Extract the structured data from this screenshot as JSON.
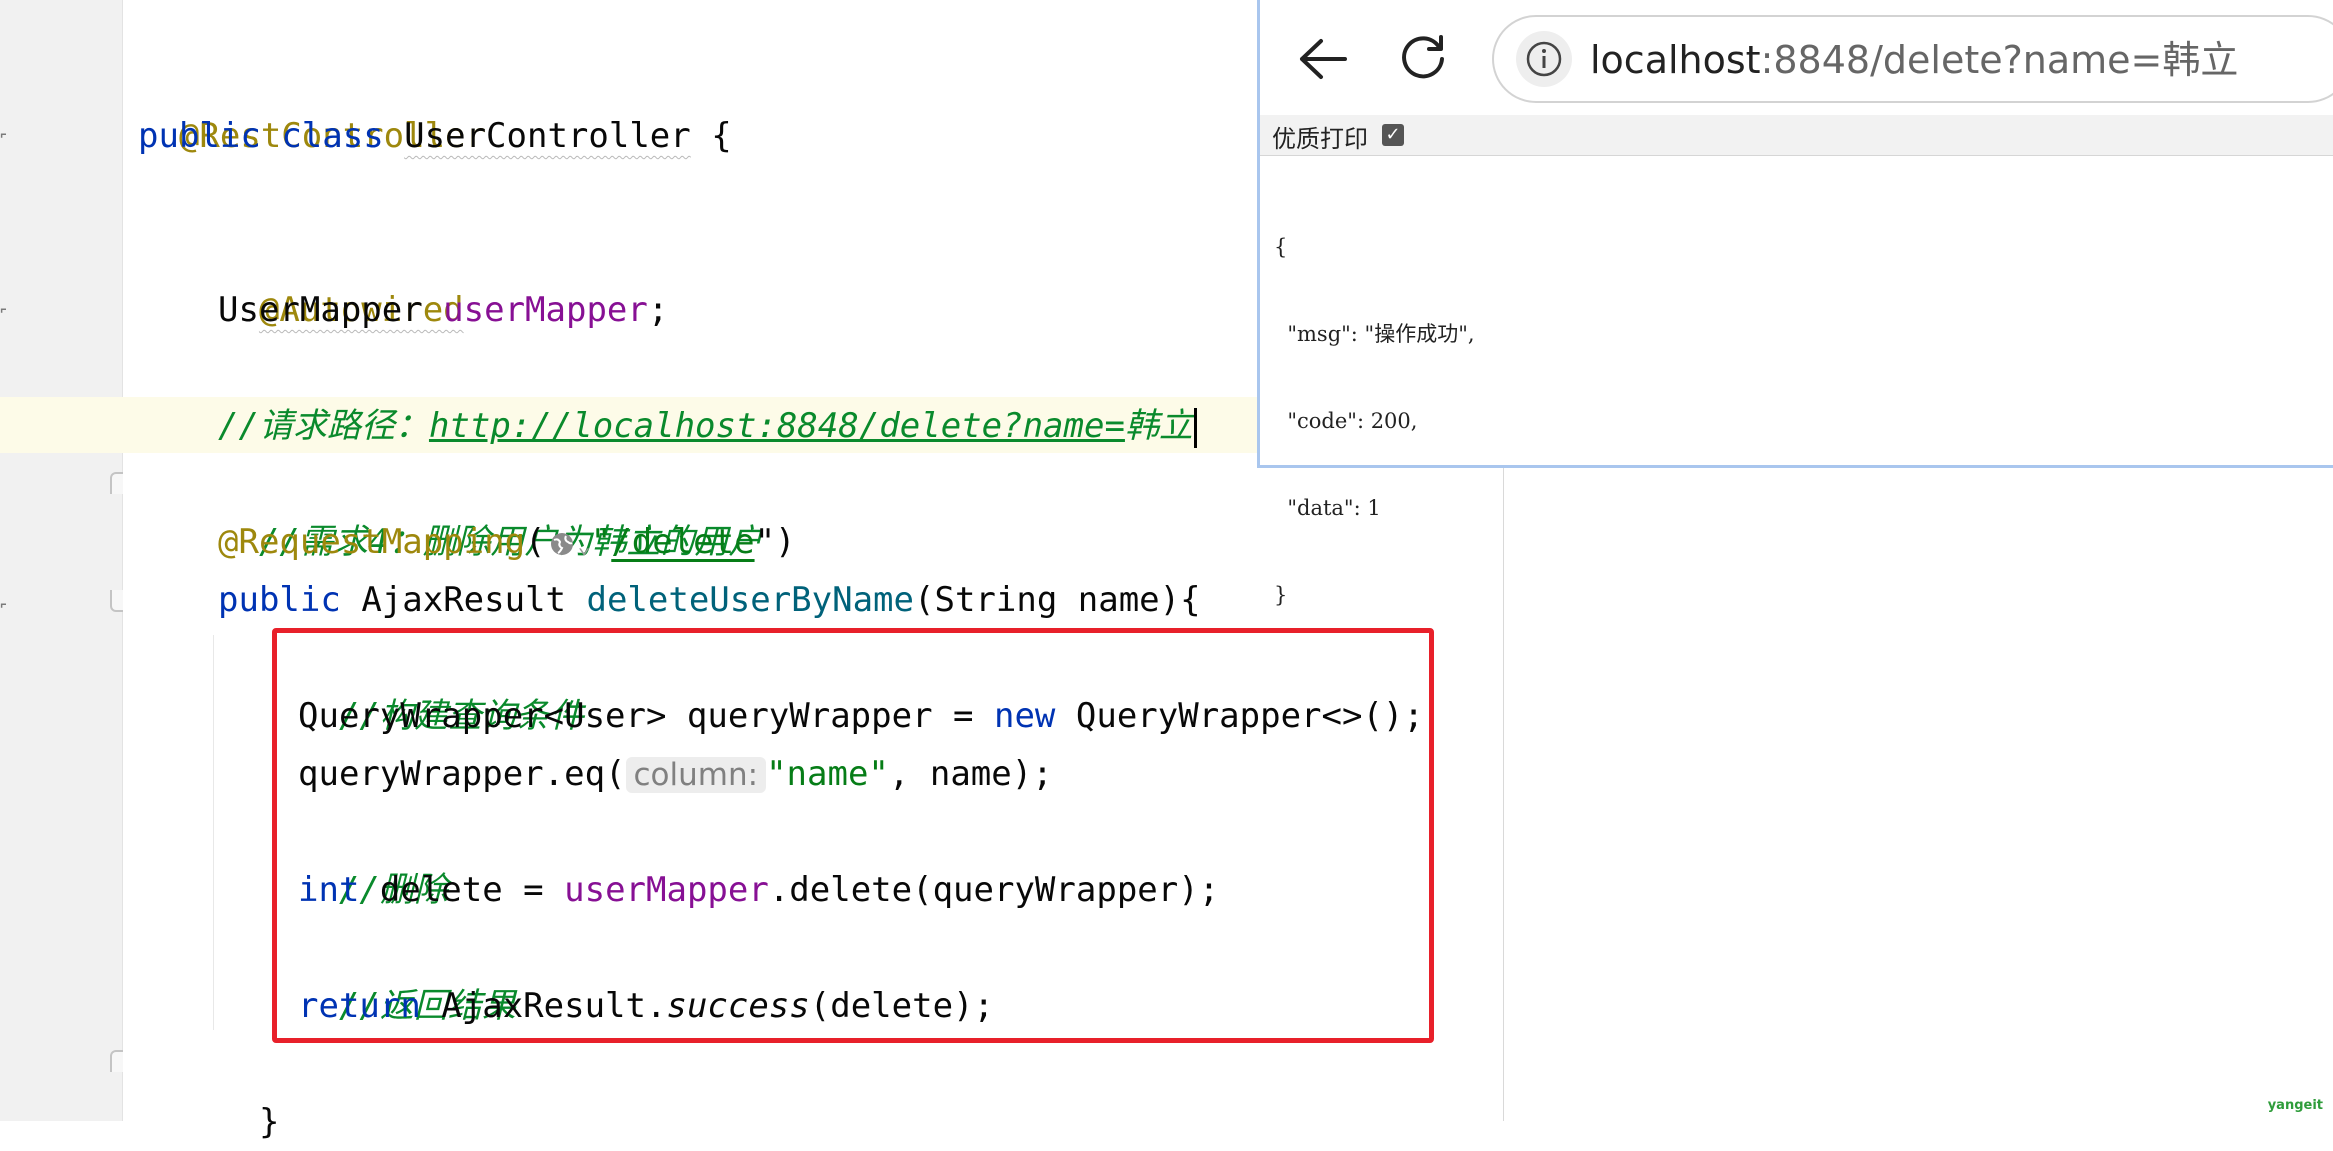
{
  "editor": {
    "annotation_rest": "@RestController",
    "kw_public": "public",
    "kw_class": "class",
    "class_name": "UserController",
    "open_brace": " {",
    "annotation_autowired": "@Autowired",
    "field_type": "UserMapper ",
    "field_name": "userMapper",
    "semicolon": ";",
    "comment_path_prefix": "//请求路径：",
    "comment_path_url": "http://localhost:8848/delete?name=",
    "comment_path_tail": "韩立",
    "comment_req": "//需求4：删除用户为韩立的用户",
    "annotation_mapping": "@RequestMapping",
    "paren_open": "(",
    "quote": "\"",
    "mapping_path": "/delete",
    "paren_close_quote": "\")",
    "return_type": "AjaxResult ",
    "method_name": "deleteUserByName",
    "method_params": "(String name){",
    "comment_build": "//构建查询条件",
    "qw_decl_type": "QueryWrapper<User> queryWrapper = ",
    "kw_new": "new",
    "qw_ctor": " QueryWrapper<>();",
    "qw_eq_call": "queryWrapper.eq(",
    "hint_column": "column:",
    "str_name": "\"name\"",
    "qw_eq_rest": ", name);",
    "comment_delete": "//删除",
    "kw_int": "int",
    "delete_assign": " delete = ",
    "delete_call": ".delete(queryWrapper);",
    "comment_return": "//返回结果",
    "kw_return": "return",
    "ret_class": " AjaxResult.",
    "ret_method": "success",
    "ret_args": "(delete);",
    "close_brace": "}"
  },
  "browser": {
    "url_host": "localhost",
    "url_rest": ":8848/delete?name=韩立",
    "pretty_print_label": "优质打印",
    "pretty_print_checked": true,
    "json_lines": [
      "{",
      "  \"msg\": \"操作成功\",",
      "  \"code\": 200,",
      "  \"data\": 1",
      "}"
    ]
  },
  "watermark": "yangeit"
}
